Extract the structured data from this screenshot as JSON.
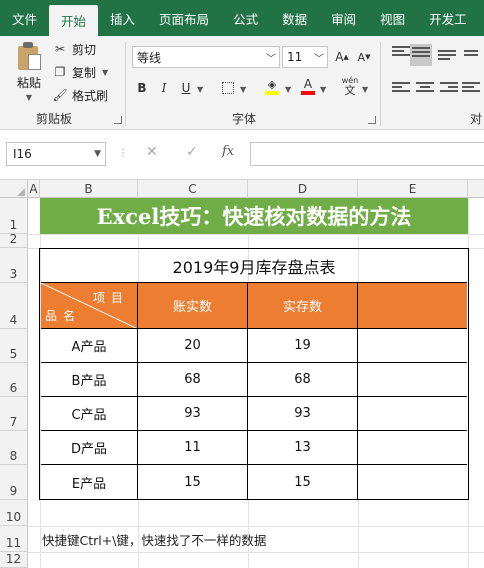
{
  "ribbon": {
    "tabs": [
      "文件",
      "开始",
      "插入",
      "页面布局",
      "公式",
      "数据",
      "审阅",
      "视图",
      "开发工"
    ],
    "active_tab": "开始",
    "clipboard": {
      "paste": "粘贴",
      "cut": "剪切",
      "copy": "复制",
      "format_painter": "格式刷",
      "group_label": "剪贴板"
    },
    "font": {
      "font_name": "等线",
      "font_size": "11",
      "grow": "A",
      "shrink": "A",
      "bold": "B",
      "italic": "I",
      "underline": "U",
      "font_color_letter": "A",
      "phonetic": "wén",
      "phonetic_char": "文",
      "group_label": "字体"
    },
    "alignment": {
      "group_label": "对"
    },
    "colors": {
      "tab_bar": "#217346",
      "ribbon_bg": "#f3f3f3"
    }
  },
  "formula_bar": {
    "name_box": "I16",
    "fx": "fx",
    "formula": ""
  },
  "grid": {
    "columns": [
      "A",
      "B",
      "C",
      "D",
      "E"
    ],
    "rows": [
      "1",
      "2",
      "3",
      "4",
      "5",
      "6",
      "7",
      "8",
      "9",
      "10",
      "11",
      "12"
    ]
  },
  "sheet": {
    "banner": "Excel技巧：快速核对数据的方法",
    "table_title": "2019年9月库存盘点表",
    "header": {
      "diag_top": "项目",
      "diag_bottom": "品名",
      "col_book": "账实数",
      "col_actual": "实存数",
      "col_extra": ""
    },
    "rows": [
      {
        "item": "A产品",
        "book": "20",
        "actual": "19"
      },
      {
        "item": "B产品",
        "book": "68",
        "actual": "68"
      },
      {
        "item": "C产品",
        "book": "93",
        "actual": "93"
      },
      {
        "item": "D产品",
        "book": "11",
        "actual": "13"
      },
      {
        "item": "E产品",
        "book": "15",
        "actual": "15"
      }
    ],
    "note": "快捷键Ctrl+\\键，快速找了不一样的数据",
    "colors": {
      "banner": "#70ad47",
      "header": "#ed7d31"
    }
  }
}
